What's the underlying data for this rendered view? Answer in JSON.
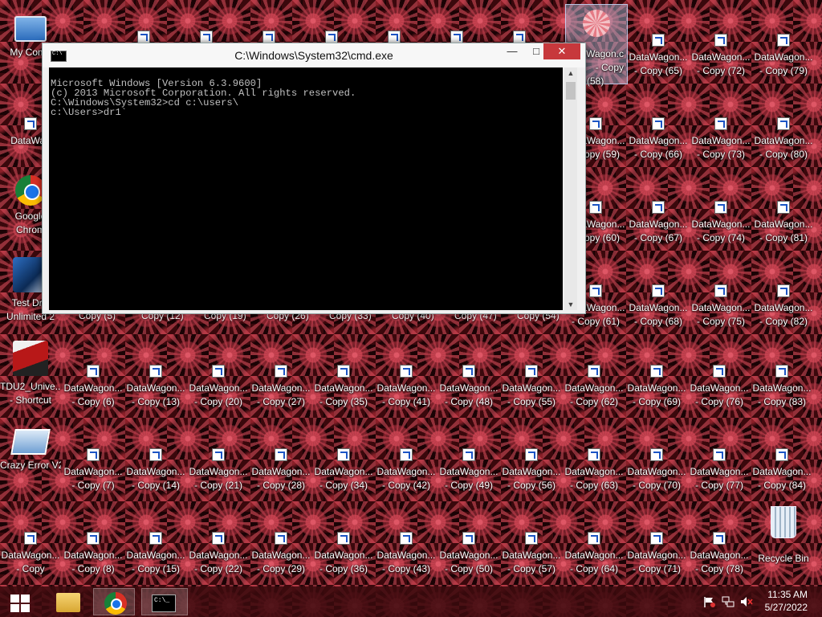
{
  "desktop": {
    "column1": [
      {
        "name": "my-computer-icon",
        "label": "My Comp",
        "kind": "pc"
      },
      {
        "name": "datawagon-icon",
        "label": "DataWag",
        "kind": "shortcut"
      },
      {
        "name": "google-chrome-icon",
        "label1": "Google",
        "label2": "Chrom",
        "kind": "chrome"
      },
      {
        "name": "test-drive-icon",
        "label1": "Test Driv",
        "label2": "Unlimited 2",
        "kind": "game"
      },
      {
        "name": "tdu2-shortcut-icon",
        "label1": "TDU2_Unive...",
        "label2": "- Shortcut",
        "kind": "car"
      },
      {
        "name": "crazy-error-icon",
        "label1": "Crazy Error V2",
        "label2": "",
        "kind": "err"
      },
      {
        "name": "datawagon-copy-icon",
        "label1": "DataWagon...",
        "label2": "- Copy",
        "kind": "shortcut"
      }
    ],
    "rows": [
      {
        "copies": [
          "(58)",
          "(65)",
          "(72)",
          "(79)"
        ]
      },
      {
        "copies": [
          "(59)",
          "(66)",
          "(73)",
          "(80)"
        ]
      },
      {
        "copies": [
          "(60)",
          "(67)",
          "(74)",
          "(81)"
        ]
      },
      {
        "copies": [
          "(61)",
          "(68)",
          "(75)",
          "(82)"
        ]
      }
    ],
    "partial_row_labels": [
      "Copy (5)",
      "Copy (12)",
      "Copy (19)",
      "Copy (26)",
      "Copy (33)",
      "Copy (40)",
      "Copy (47)",
      "Copy (54)"
    ],
    "grid_labels": {
      "row5": [
        "- Copy (6)",
        "- Copy (13)",
        "- Copy (20)",
        "- Copy (27)",
        "- Copy (35)",
        "- Copy (41)",
        "- Copy (48)",
        "- Copy (55)",
        "- Copy (62)",
        "- Copy (69)",
        "- Copy (76)",
        "- Copy (83)"
      ],
      "row6": [
        "- Copy (7)",
        "- Copy (14)",
        "- Copy (21)",
        "- Copy (28)",
        "- Copy (34)",
        "- Copy (42)",
        "- Copy (49)",
        "- Copy (56)",
        "- Copy (63)",
        "- Copy (70)",
        "- Copy (77)",
        "- Copy (84)"
      ],
      "row7": [
        "- Copy (8)",
        "- Copy (15)",
        "- Copy (22)",
        "- Copy (29)",
        "- Copy (36)",
        "- Copy (43)",
        "- Copy (50)",
        "- Copy (57)",
        "- Copy (64)",
        "- Copy (71)",
        "- Copy (78)"
      ]
    },
    "datawagon_label": "DataWagon...",
    "datawagon_selected_label": "Wagon.c",
    "selected_copy_line1": "- Copy",
    "copy_prefix": "- Copy",
    "recycle_bin": "Recycle Bin"
  },
  "cmd": {
    "title": "C:\\Windows\\System32\\cmd.exe",
    "lines": [
      "Microsoft Windows [Version 6.3.9600]",
      "(c) 2013 Microsoft Corporation. All rights reserved.",
      "",
      "C:\\Windows\\System32>cd c:\\users\\",
      "",
      "c:\\Users>dr1`"
    ],
    "minimize": "—",
    "maximize": "□",
    "close": "✕"
  },
  "taskbar": {
    "time": "11:35 AM",
    "date": "5/27/2022"
  }
}
